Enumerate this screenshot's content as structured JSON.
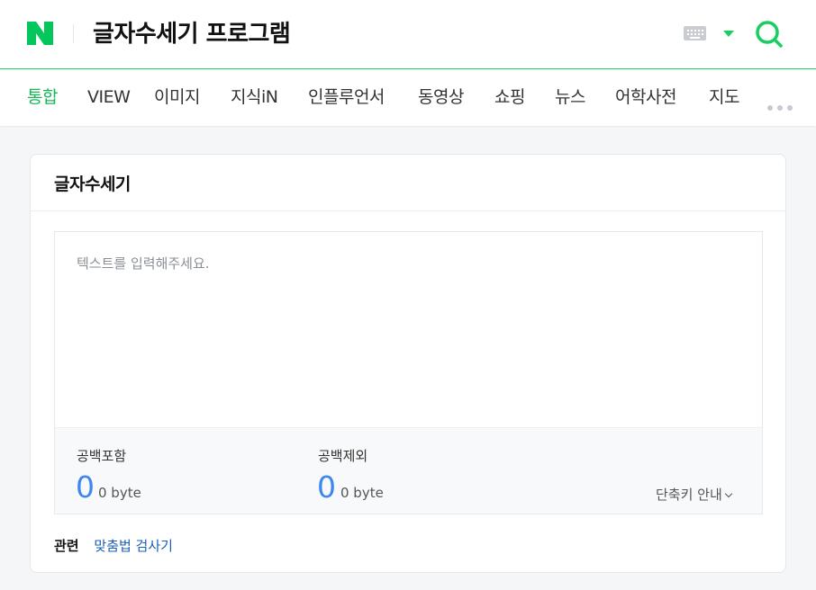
{
  "header": {
    "logo": "N",
    "query": "글자수세기 프로그램",
    "brand_color": "#19ce60"
  },
  "nav": {
    "tabs": [
      {
        "label": "통합",
        "active": true
      },
      {
        "label": "VIEW"
      },
      {
        "label": "이미지"
      },
      {
        "label": "지식iN"
      },
      {
        "label": "인플루언서"
      },
      {
        "label": "동영상"
      },
      {
        "label": "쇼핑"
      },
      {
        "label": "뉴스"
      },
      {
        "label": "어학사전"
      },
      {
        "label": "지도"
      }
    ]
  },
  "card": {
    "title": "글자수세기",
    "editor": {
      "placeholder": "텍스트를 입력해주세요.",
      "value": ""
    },
    "with_spaces": {
      "label": "공백포함",
      "count": "0",
      "bytes": "0 byte"
    },
    "without_spaces": {
      "label": "공백제외",
      "count": "0",
      "bytes": "0 byte"
    },
    "shortcut_label": "단축키 안내",
    "related": {
      "label": "관련",
      "link": "맞춤법 검사기"
    }
  },
  "colors": {
    "accent": "#19ce60",
    "count": "#3e86f0",
    "link": "#1a5fb4"
  },
  "icons": [
    "naver-logo-icon",
    "keyboard-icon",
    "caret-down-icon",
    "search-icon",
    "more-icon",
    "chevron-down-icon"
  ]
}
